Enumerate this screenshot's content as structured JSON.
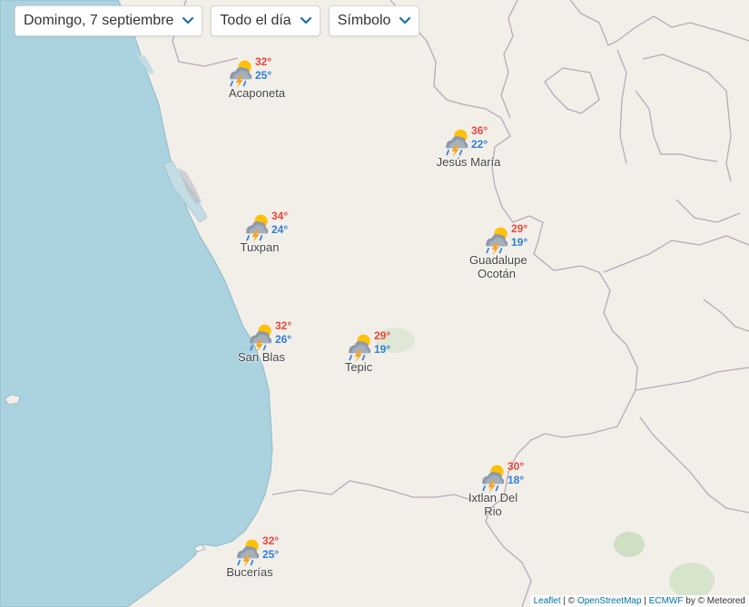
{
  "controls": {
    "date_label": "Domingo, 7 septiembre",
    "period_label": "Todo el día",
    "layer_label": "Símbolo"
  },
  "colors": {
    "sea": "#aad3df",
    "land": "#f2efe9",
    "border": "#b9a8b9",
    "coast": "#8fb8c8",
    "temp_max": "#e8473d",
    "temp_min": "#2f7fd6"
  },
  "markers": [
    {
      "name": "Acaponeta",
      "max": "32°",
      "min": "25°",
      "icon": "storm-sun-icon"
    },
    {
      "name": "Jesús María",
      "max": "36°",
      "min": "22°",
      "icon": "storm-sun-icon"
    },
    {
      "name": "Tuxpan",
      "max": "34°",
      "min": "24°",
      "icon": "storm-sun-icon"
    },
    {
      "name": "Guadalupe Ocotán",
      "max": "29°",
      "min": "19°",
      "icon": "storm-sun-icon"
    },
    {
      "name": "San Blas",
      "max": "32°",
      "min": "26°",
      "icon": "storm-sun-icon"
    },
    {
      "name": "Tepic",
      "max": "29°",
      "min": "19°",
      "icon": "storm-sun-icon"
    },
    {
      "name": "Ixtlan Del Rio",
      "max": "30°",
      "min": "18°",
      "icon": "storm-sun-icon"
    },
    {
      "name": "Bucerías",
      "max": "32°",
      "min": "25°",
      "icon": "storm-sun-icon"
    }
  ],
  "attribution": {
    "leaflet": "Leaflet",
    "sep1": " | © ",
    "osm": "OpenStreetMap",
    "sep2": " | ",
    "ecmwf": "ECMWF",
    "by": " by © Meteored"
  }
}
